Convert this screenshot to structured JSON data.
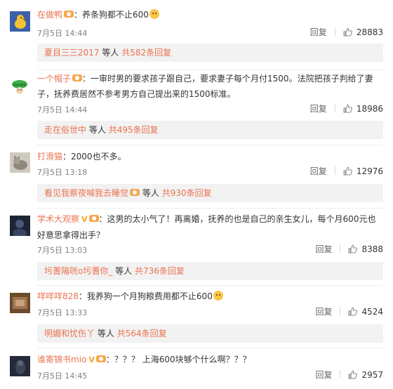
{
  "colors": {
    "username": "#eb7350",
    "link": "#eb7350",
    "meta": "#808080",
    "subbar": "#f2f2f2"
  },
  "reply_label": "回复",
  "wait_label": "等人",
  "comments": [
    {
      "user": "在做鸭",
      "text": "养条狗都不止600",
      "has_emoji": true,
      "time": "7月5日 14:44",
      "likes": "28883",
      "sub_user": "夏目三三2017",
      "sub_count": "共582条回复",
      "avatar": "duck"
    },
    {
      "user": "一个帽子",
      "text": "一审时男的要求孩子跟自己，要求妻子每个月付1500。法院把孩子判给了妻子，抚养费居然不参考男方自己提出来的1500标准。",
      "time": "7月5日 14:44",
      "likes": "18986",
      "sub_user": "走在俗世中",
      "sub_count": "共495条回复",
      "avatar": "green-hat"
    },
    {
      "user": "打滑猫",
      "text": "2000也不多。",
      "time": "7月5日 13:18",
      "likes": "12976",
      "sub_user": "看见我蔡夜喊我去睡觉",
      "sub_count": "共930条回复",
      "avatar": "cat"
    },
    {
      "user": "学术大观察",
      "vip": "V",
      "text": "这男的太小气了！再离婚，抚养的也是自己的亲生女儿，每个月600元也好意思拿得出手？",
      "time": "7月5日 13:03",
      "likes": "8388",
      "sub_user": "圬蓍陽咣o圬蓍你_",
      "sub_count": "共736条回复",
      "avatar": "dark"
    },
    {
      "user": "咩咩咩828",
      "text": "我养狗一个月狗粮费用都不止600",
      "has_emoji": true,
      "time": "7月5日 13:33",
      "likes": "4524",
      "sub_user": "明媚和忧伤丫",
      "sub_count": "共564条回复",
      "avatar": "brown"
    },
    {
      "user": "谁寄锦书mio",
      "vip": "V",
      "text": "？？？ 上海600块够个什么啊？？？",
      "time": "7月5日 14:45",
      "likes": "2957",
      "avatar": "night"
    }
  ]
}
